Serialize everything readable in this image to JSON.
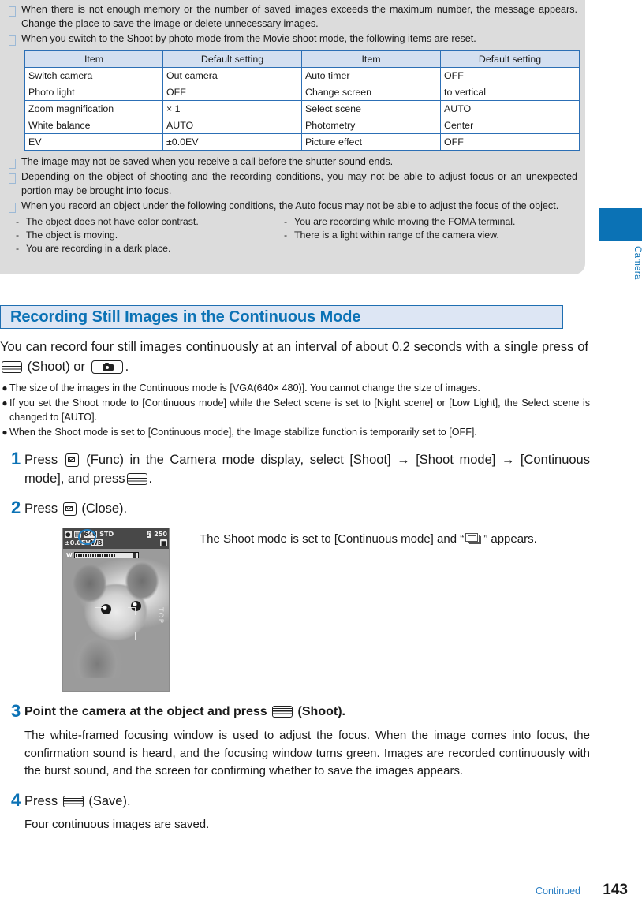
{
  "colors": {
    "accent_blue": "#0b72b5",
    "heading_bg": "#dde6f4",
    "heading_border": "#1f6fb2",
    "table_header_bg": "#d3dff0",
    "table_border": "#2c6fb5",
    "note_box_bg": "#dcdcdc"
  },
  "notes": [
    "When there is not enough memory or the number of saved images exceeds the maximum number, the message appears. Change the place to save the image or delete unnecessary images.",
    "When you switch to the Shoot by photo mode from the Movie shoot mode, the following items are reset.",
    "The image may not be saved when you receive a call before the shutter sound ends.",
    "Depending on the object of shooting and the recording conditions, you may not be able to adjust focus or an unexpected portion may be brought into focus.",
    "When you record an object under the following conditions, the Auto focus may not be able to adjust the focus of the object."
  ],
  "defaults_table": {
    "headers": [
      "Item",
      "Default setting",
      "Item",
      "Default setting"
    ],
    "rows": [
      [
        "Switch camera",
        "Out camera",
        "Auto timer",
        "OFF"
      ],
      [
        "Photo light",
        "OFF",
        "Change screen",
        "to vertical"
      ],
      [
        "Zoom magnification",
        "× 1",
        "Select scene",
        "AUTO"
      ],
      [
        "White balance",
        "AUTO",
        "Photometry",
        "Center"
      ],
      [
        "EV",
        "±0.0EV",
        "Picture effect",
        "OFF"
      ]
    ]
  },
  "autofocus_conditions": {
    "left": [
      "The object does not have color contrast.",
      "The object is moving.",
      "You are recording in a dark place."
    ],
    "right": [
      "You are recording while moving the FOMA terminal.",
      "There is a light within range of the camera view."
    ],
    "dash": "-"
  },
  "side_tab": {
    "label": "Camera"
  },
  "section": {
    "heading": "Recording Still Images in the Continuous Mode",
    "intro_part1": "You can record four still images continuously at an interval of about 0.2 seconds with a single press of ",
    "intro_shoot_label": "(Shoot) or",
    "intro_end": ".",
    "bullets": [
      "The size of the images in the Continuous mode is [VGA(640× 480)]. You cannot change the size of images.",
      "If you set the Shoot mode to [Continuous mode] while the Select scene is set to [Night scene] or [Low Light], the Select scene is changed to [AUTO].",
      "When the Shoot mode is set to [Continuous mode], the Image stabilize function is temporarily set to [OFF]."
    ],
    "bullet_dot": "●"
  },
  "steps": [
    {
      "number": "1",
      "title_a": "Press",
      "title_b": "(Func) in the Camera mode display, select [Shoot] → [Shoot mode] → [Continuous mode], and press",
      "title_c": ".",
      "desc": ""
    },
    {
      "number": "2",
      "title_a": "Press",
      "title_b": "(Close).",
      "title_c": "",
      "desc": ""
    },
    {
      "number": "3",
      "title_a": "Point the camera at the object and press",
      "title_b": "(Shoot).",
      "title_c": "",
      "desc": "The white-framed focusing window is used to adjust the focus. When the image comes into focus, the confirmation sound is heard, and the focusing window turns green. Images are recorded continuously with the burst sound, and the screen for confirming whether to save the images appears."
    },
    {
      "number": "4",
      "title_a": "Press",
      "title_b": "(Save).",
      "title_c": "",
      "desc": "Four continuous images are saved."
    }
  ],
  "screenshot": {
    "caption_before": "The Shoot mode is set to [Continuous mode] and “",
    "caption_after": "” appears.",
    "status_bar": {
      "resolution": "640",
      "quality": "STD",
      "shots_remaining": "250",
      "ev": "±0.0EV",
      "white_balance": "WB",
      "zoom_label": "W"
    },
    "top_marker": "TOP"
  },
  "footer": {
    "continued": "Continued",
    "page_number": "143"
  }
}
